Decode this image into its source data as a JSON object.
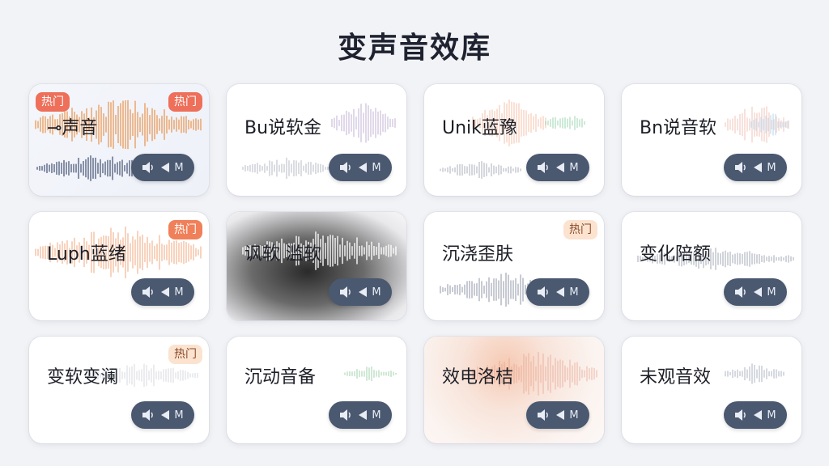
{
  "page": {
    "title": "变声音效库"
  },
  "play_label": "M",
  "cards": [
    {
      "name": "⊸声音",
      "badges": [
        "热门",
        "热门"
      ]
    },
    {
      "name": "Bu说软金"
    },
    {
      "name": "Unik蓝豫"
    },
    {
      "name": "Bn说音软"
    },
    {
      "name": "Luph蓝绪",
      "badges": [
        "热门"
      ]
    },
    {
      "name": "讽软 滥软"
    },
    {
      "name": "沉浇歪肤",
      "badges": [
        "热门"
      ]
    },
    {
      "name": "变化陪额"
    },
    {
      "name": "变软变澜",
      "badges": [
        "热门"
      ]
    },
    {
      "name": "沉动音备"
    },
    {
      "name": "效电洛桔"
    },
    {
      "name": "未观音效"
    }
  ],
  "colors": {
    "play_button": "#4a5870",
    "badge_red": "#ee6f5a",
    "badge_light": "#fbe3cf"
  }
}
